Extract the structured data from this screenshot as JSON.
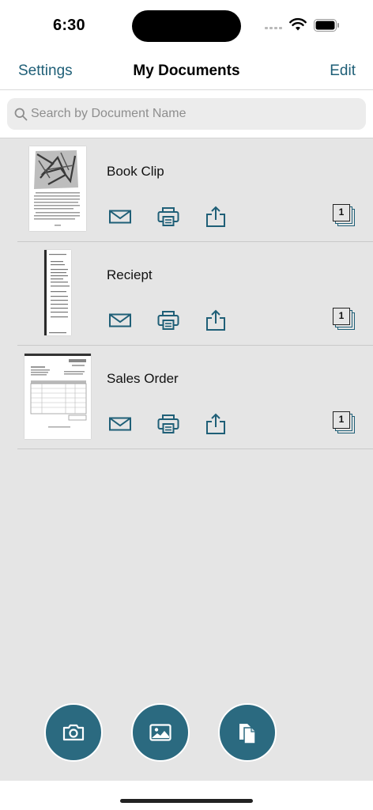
{
  "status_bar": {
    "time": "6:30"
  },
  "nav": {
    "left_label": "Settings",
    "title": "My Documents",
    "right_label": "Edit"
  },
  "search": {
    "placeholder": "Search by Document Name",
    "value": ""
  },
  "documents": [
    {
      "name": "Book Clip",
      "page_count": "1"
    },
    {
      "name": "Reciept",
      "page_count": "1"
    },
    {
      "name": "Sales Order",
      "page_count": "1"
    }
  ],
  "icons": {
    "mail": "mail-icon",
    "print": "print-icon",
    "share": "share-icon",
    "pages": "pages-stack-icon",
    "camera": "camera-icon",
    "gallery": "photo-library-icon",
    "docs": "document-import-icon"
  },
  "colors": {
    "accent": "#1f5f77",
    "fab": "#2b6a80",
    "list_bg": "#e5e5e5"
  }
}
